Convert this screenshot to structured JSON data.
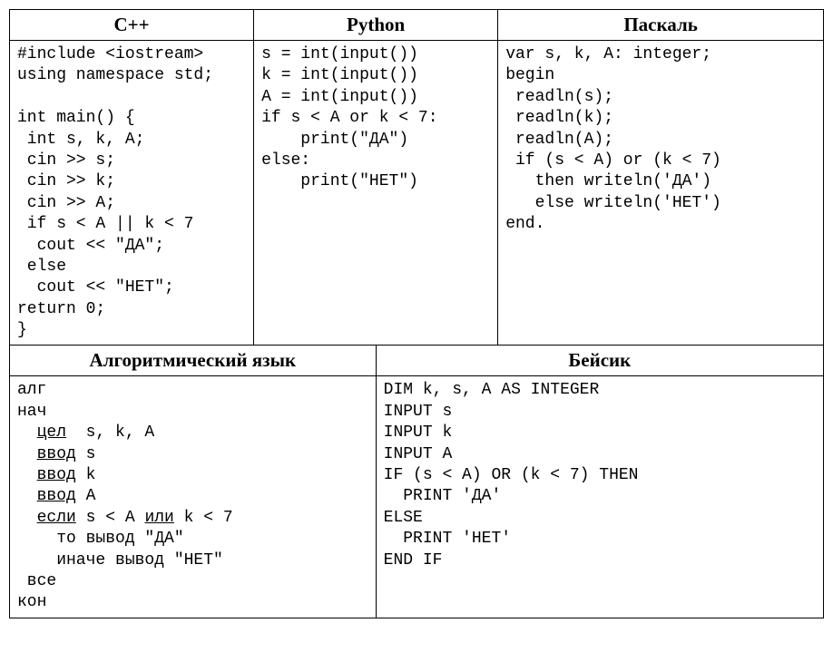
{
  "top": {
    "cpp": {
      "header": "C++",
      "code": "#include <iostream>\nusing namespace std;\n\nint main() {\n int s, k, A;\n cin >> s;\n cin >> k;\n cin >> A;\n if s < A || k < 7\n  cout << \"ДА\";\n else\n  cout << \"НЕТ\";\nreturn 0;\n}"
    },
    "python": {
      "header": "Python",
      "code": "s = int(input())\nk = int(input())\nA = int(input())\nif s < A or k < 7:\n    print(\"ДА\")\nelse:\n    print(\"НЕТ\")"
    },
    "pascal": {
      "header": "Паскаль",
      "code": "var s, k, A: integer;\nbegin\n readln(s);\n readln(k);\n readln(A);\n if (s < A) or (k < 7)\n   then writeln('ДА')\n   else writeln('НЕТ')\nend."
    }
  },
  "bottom": {
    "algo": {
      "header": "Алгоритмический язык",
      "lines": [
        {
          "t": "алг"
        },
        {
          "t": "нач"
        },
        {
          "pre": "  ",
          "kw": "цел",
          "rest": "  s, k, A"
        },
        {
          "pre": "  ",
          "kw": "ввод",
          "rest": " s"
        },
        {
          "pre": "  ",
          "kw": "ввод",
          "rest": " k"
        },
        {
          "pre": "  ",
          "kw": "ввод",
          "rest": " A"
        },
        {
          "pre": "  ",
          "kw": "если",
          "mid": " s < A ",
          "kw2": "или",
          "rest": " k < 7"
        },
        {
          "t": "    то вывод \"ДА\""
        },
        {
          "t": "    иначе вывод \"НЕТ\""
        },
        {
          "t": " все"
        },
        {
          "t": "кон"
        }
      ]
    },
    "basic": {
      "header": "Бейсик",
      "code": "DIM k, s, A AS INTEGER\nINPUT s\nINPUT k\nINPUT A\nIF (s < A) OR (k < 7) THEN\n  PRINT 'ДА'\nELSE\n  PRINT 'НЕТ'\nEND IF"
    }
  }
}
